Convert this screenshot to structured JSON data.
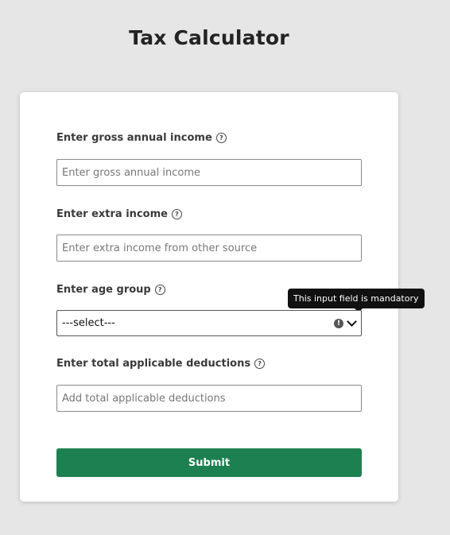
{
  "header": {
    "title": "Tax Calculator"
  },
  "form": {
    "gross_income": {
      "label": "Enter gross annual income",
      "placeholder": "Enter gross annual income",
      "value": ""
    },
    "extra_income": {
      "label": "Enter extra income",
      "placeholder": "Enter extra income from other source",
      "value": ""
    },
    "age_group": {
      "label": "Enter age group",
      "selected": "---select---",
      "tooltip": "This input field is mandatory"
    },
    "deductions": {
      "label": "Enter total applicable deductions",
      "placeholder": "Add total applicable deductions",
      "value": ""
    },
    "submit_label": "Submit"
  },
  "icons": {
    "help": "help-circle-icon",
    "warning": "exclamation-circle-icon",
    "chevron": "chevron-down-icon"
  },
  "colors": {
    "background": "#e6e6e6",
    "card": "#ffffff",
    "submit_button": "#1d8050",
    "tooltip": "#111111"
  }
}
